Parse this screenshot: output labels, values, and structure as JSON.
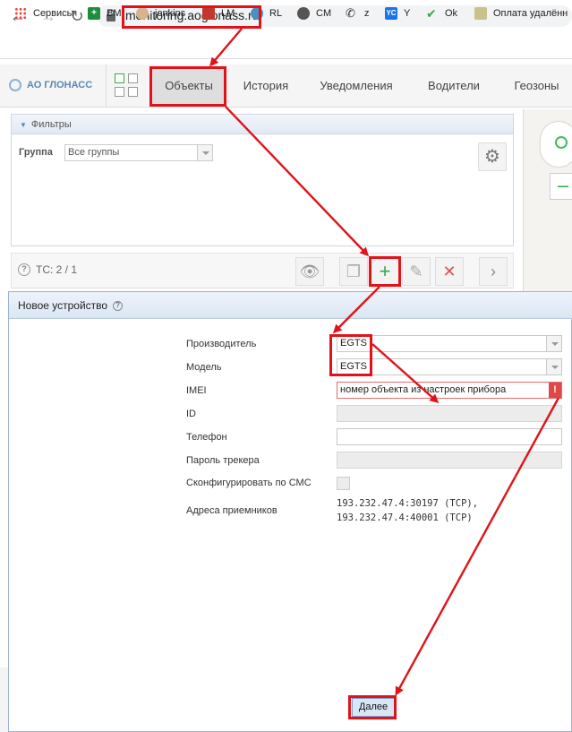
{
  "browser": {
    "url": "monitoring.aoglonass.ru",
    "bookmarks": [
      "Сервисы",
      "BM",
      "jenkins",
      "LM",
      "RL",
      "CM",
      "z",
      "Y",
      "Ok",
      "Оплата удалённ"
    ],
    "bookmark_yc_label": "YC"
  },
  "app": {
    "logo": "АО ГЛОНАСС",
    "tabs": [
      "Объекты",
      "История",
      "Уведомления",
      "Водители",
      "Геозоны"
    ],
    "active_tab": "Объекты"
  },
  "filters": {
    "header": "Фильтры",
    "group_label": "Группа",
    "group_value": "Все группы"
  },
  "toolbar": {
    "ts_label": "ТС: 2 / 1"
  },
  "dialog": {
    "title": "Новое устройство",
    "fields": {
      "manufacturer_label": "Производитель",
      "manufacturer_value": "EGTS",
      "model_label": "Модель",
      "model_value": "EGTS",
      "imei_label": "IMEI",
      "imei_value": "номер объекта из настроек прибора",
      "id_label": "ID",
      "phone_label": "Телефон",
      "tracker_password_label": "Пароль трекера",
      "configure_sms_label": "Сконфигурировать по СМС",
      "receiver_addresses_label": "Адреса приемников",
      "receiver_address_1": "193.232.47.4:30197 (TCP),",
      "receiver_address_2": "193.232.47.4:40001 (TCP)"
    },
    "next_label": "Далее"
  },
  "colors": {
    "annotation_red": "#e0131a",
    "active_tab_bg": "#dedede",
    "add_green": "#3aa64a",
    "delete_red": "#e05050"
  }
}
